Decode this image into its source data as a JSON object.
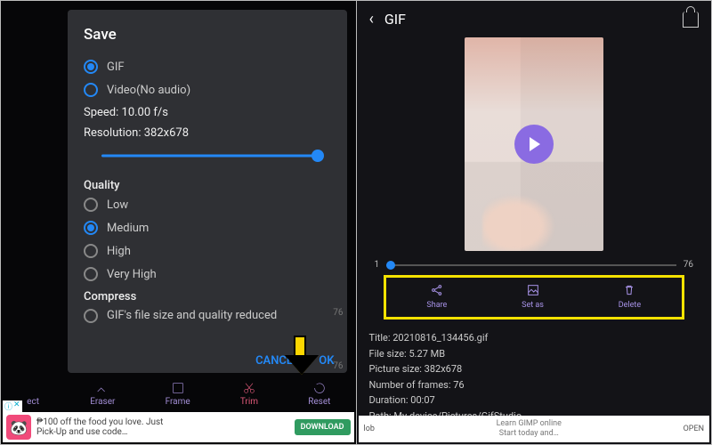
{
  "left": {
    "modal": {
      "title": "Save",
      "format": {
        "options": [
          {
            "label": "GIF",
            "checked": true
          },
          {
            "label": "Video(No audio)",
            "checked": false
          }
        ]
      },
      "speed_label": "Speed: 10.00 f/s",
      "resolution_label": "Resolution: 382x678",
      "quality_heading": "Quality",
      "quality_options": [
        {
          "label": "Low",
          "checked": false
        },
        {
          "label": "Medium",
          "checked": true
        },
        {
          "label": "High",
          "checked": false
        },
        {
          "label": "Very High",
          "checked": false
        }
      ],
      "compress_heading": "Compress",
      "compress_option": "GIF's file size and quality reduced",
      "cancel": "CANCEL",
      "ok": "OK"
    },
    "ticks": {
      "a": "76",
      "b": "76"
    },
    "bottomnav": [
      {
        "label": "ect"
      },
      {
        "label": "Eraser"
      },
      {
        "label": "Frame"
      },
      {
        "label": "Trim",
        "active": true
      },
      {
        "label": "Reset"
      }
    ],
    "ad": {
      "line1": "₱100 off the food you love. Just",
      "line2": "Pick-Up and use code…",
      "cta": "DOWNLOAD"
    }
  },
  "right": {
    "header_title": "GIF",
    "slider": {
      "start": "1",
      "end": "76"
    },
    "actions": [
      {
        "name": "share",
        "label": "Share"
      },
      {
        "name": "setas",
        "label": "Set as"
      },
      {
        "name": "delete",
        "label": "Delete"
      }
    ],
    "meta": {
      "title": "Title: 20210816_134456.gif",
      "filesize": "File size: 5.27 MB",
      "picsize": "Picture size: 382x678",
      "frames": "Number of frames: 76",
      "duration": "Duration: 00:07",
      "path": "Path: My device/Pictures/GifStudio"
    },
    "ad": {
      "tag": "lob",
      "line1": "Learn GIMP online",
      "line2": "Start today and…",
      "cta": "OPEN"
    }
  }
}
